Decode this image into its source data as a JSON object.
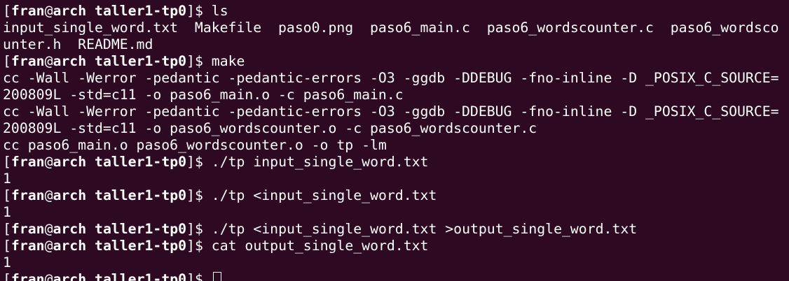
{
  "colors": {
    "background": "#2d0922",
    "foreground": "#ffffff"
  },
  "terminal": {
    "lines": [
      {
        "kind": "prompt",
        "open": "[",
        "user": "fran",
        "at": "@",
        "host": "arch",
        "sep": " ",
        "cwd": "taller1-tp0",
        "close": "]$ ",
        "cmd": "ls"
      },
      {
        "kind": "output",
        "text": "input_single_word.txt  Makefile  paso0.png  paso6_main.c  paso6_wordscounter.c  paso6_wordsco"
      },
      {
        "kind": "output",
        "text": "unter.h  README.md"
      },
      {
        "kind": "prompt",
        "open": "[",
        "user": "fran",
        "at": "@",
        "host": "arch",
        "sep": " ",
        "cwd": "taller1-tp0",
        "close": "]$ ",
        "cmd": "make"
      },
      {
        "kind": "output",
        "text": "cc -Wall -Werror -pedantic -pedantic-errors -O3 -ggdb -DDEBUG -fno-inline -D _POSIX_C_SOURCE="
      },
      {
        "kind": "output",
        "text": "200809L -std=c11 -o paso6_main.o -c paso6_main.c"
      },
      {
        "kind": "output",
        "text": "cc -Wall -Werror -pedantic -pedantic-errors -O3 -ggdb -DDEBUG -fno-inline -D _POSIX_C_SOURCE="
      },
      {
        "kind": "output",
        "text": "200809L -std=c11 -o paso6_wordscounter.o -c paso6_wordscounter.c"
      },
      {
        "kind": "output",
        "text": "cc paso6_main.o paso6_wordscounter.o -o tp -lm"
      },
      {
        "kind": "prompt",
        "open": "[",
        "user": "fran",
        "at": "@",
        "host": "arch",
        "sep": " ",
        "cwd": "taller1-tp0",
        "close": "]$ ",
        "cmd": "./tp input_single_word.txt"
      },
      {
        "kind": "output",
        "text": "1"
      },
      {
        "kind": "prompt",
        "open": "[",
        "user": "fran",
        "at": "@",
        "host": "arch",
        "sep": " ",
        "cwd": "taller1-tp0",
        "close": "]$ ",
        "cmd": "./tp <input_single_word.txt"
      },
      {
        "kind": "output",
        "text": "1"
      },
      {
        "kind": "prompt",
        "open": "[",
        "user": "fran",
        "at": "@",
        "host": "arch",
        "sep": " ",
        "cwd": "taller1-tp0",
        "close": "]$ ",
        "cmd": "./tp <input_single_word.txt >output_single_word.txt"
      },
      {
        "kind": "prompt",
        "open": "[",
        "user": "fran",
        "at": "@",
        "host": "arch",
        "sep": " ",
        "cwd": "taller1-tp0",
        "close": "]$ ",
        "cmd": "cat output_single_word.txt"
      },
      {
        "kind": "output",
        "text": "1"
      },
      {
        "kind": "prompt",
        "open": "[",
        "user": "fran",
        "at": "@",
        "host": "arch",
        "sep": " ",
        "cwd": "taller1-tp0",
        "close": "]$ ",
        "cmd": "",
        "cursor": true
      }
    ]
  }
}
